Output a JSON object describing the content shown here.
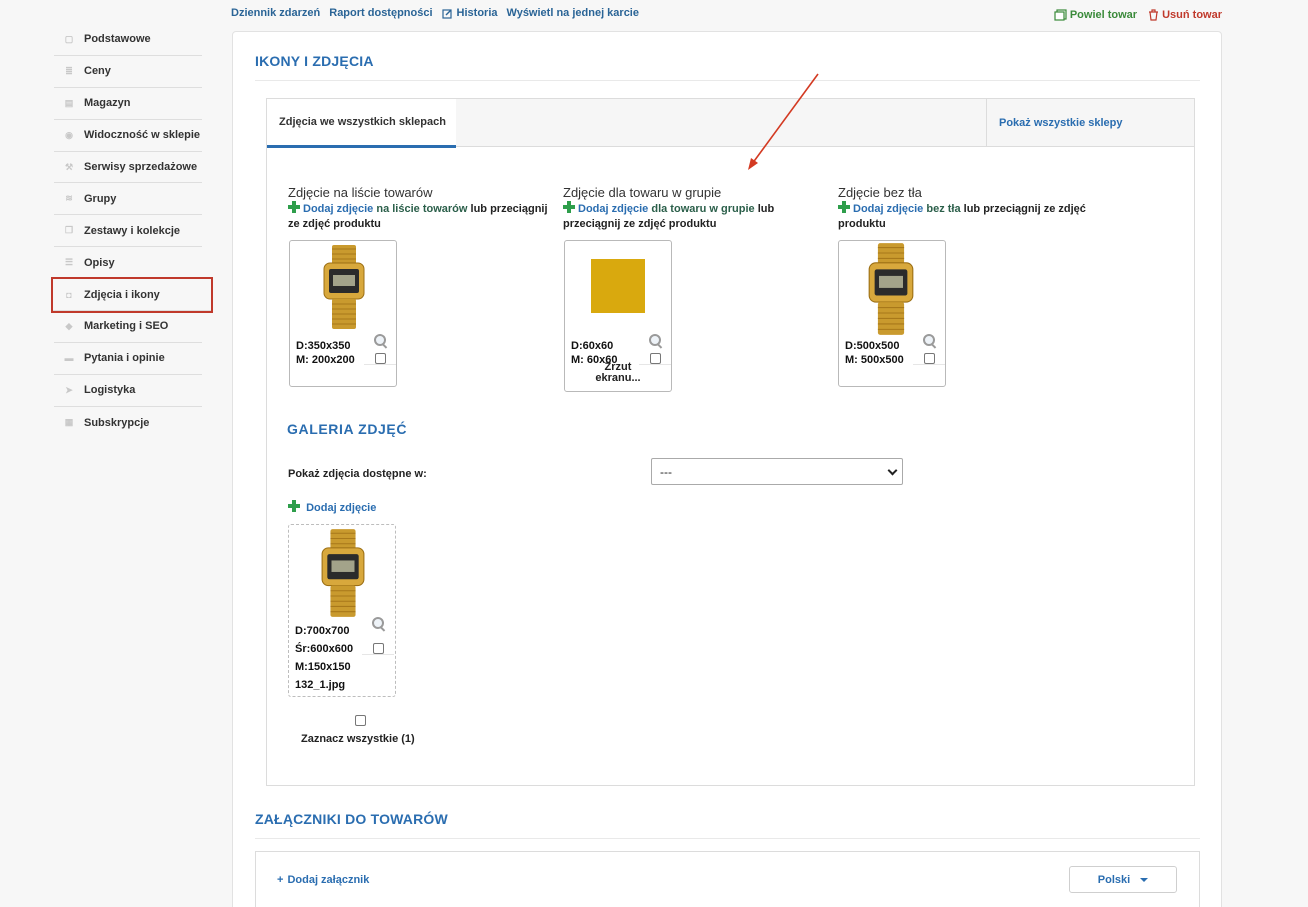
{
  "top_links": [
    "Dziennik zdarzeń",
    "Raport dostępności",
    "Historia",
    "Wyświetl na jednej karcie"
  ],
  "top_actions": {
    "copy": "Powiel towar",
    "delete": "Usuń towar"
  },
  "sidebar": {
    "items": [
      {
        "label": "Podstawowe",
        "icon": "box-icon"
      },
      {
        "label": "Ceny",
        "icon": "price-icon"
      },
      {
        "label": "Magazyn",
        "icon": "warehouse-icon"
      },
      {
        "label": "Widoczność w sklepie",
        "icon": "eye-icon"
      },
      {
        "label": "Serwisy sprzedażowe",
        "icon": "gavel-icon"
      },
      {
        "label": "Grupy",
        "icon": "layers-icon"
      },
      {
        "label": "Zestawy i kolekcje",
        "icon": "copy-icon"
      },
      {
        "label": "Opisy",
        "icon": "lines-icon"
      },
      {
        "label": "Zdjęcia i ikony",
        "icon": "camera-icon"
      },
      {
        "label": "Marketing i SEO",
        "icon": "tag-icon"
      },
      {
        "label": "Pytania i opinie",
        "icon": "chat-icon"
      },
      {
        "label": "Logistyka",
        "icon": "send-icon"
      },
      {
        "label": "Subskrypcje",
        "icon": "calendar-icon"
      }
    ],
    "active_label": "Zdjęcia i ikony"
  },
  "icons_section": {
    "title": "IKONY I ZDJĘCIA",
    "tab_active": "Zdjęcia we wszystkich sklepach",
    "tab_show_all": "Pokaż wszystkie sklepy",
    "columns": [
      {
        "heading": "Zdjęcie na liście towarów",
        "add_link": "Dodaj zdjęcie",
        "add_target": "na liście towarów",
        "rest": "lub przeciągnij ze zdjęć produktu",
        "dims_1": "D:350x350",
        "dims_2": "M: 200x200",
        "filename": ""
      },
      {
        "heading": "Zdjęcie dla towaru w grupie",
        "add_link": "Dodaj zdjęcie",
        "add_target": "dla towaru w grupie",
        "rest": "lub przeciągnij ze zdjęć produktu",
        "dims_1": "D:60x60",
        "dims_2": "M: 60x60",
        "filename": "Zrzut ekranu..."
      },
      {
        "heading": "Zdjęcie bez tła",
        "add_link": "Dodaj zdjęcie",
        "add_target": "bez tła",
        "rest": "lub przeciągnij ze zdjęć produktu",
        "dims_1": "D:500x500",
        "dims_2": "M: 500x500",
        "filename": ""
      }
    ],
    "swatch_color": "#d9a90e"
  },
  "gallery": {
    "title": "GALERIA ZDJĘĆ",
    "filter_label": "Pokaż zdjęcia dostępne w:",
    "filter_value": "---",
    "add_label": "Dodaj zdjęcie",
    "item": {
      "dims_d": "D:700x700",
      "dims_sr": "Śr:600x600",
      "dims_m": "M:150x150",
      "filename": "132_1.jpg"
    },
    "select_all": "Zaznacz wszystkie (1)"
  },
  "attachments": {
    "title": "ZAŁĄCZNIKI DO TOWARÓW",
    "add_label": "Dodaj załącznik",
    "language": "Polski"
  },
  "colors": {
    "accent_blue": "#2a6db0",
    "add_green": "#2e9e4b",
    "danger_red": "#c0392b"
  }
}
